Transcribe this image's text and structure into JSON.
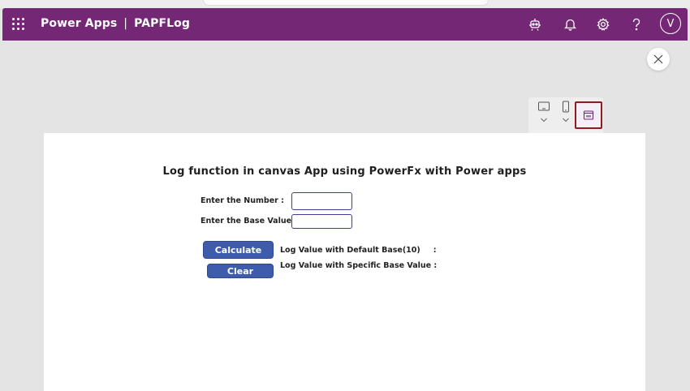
{
  "header": {
    "product": "Power Apps",
    "separator": "|",
    "app_name": "PAPFLog",
    "avatar_initial": "V"
  },
  "app": {
    "title": "Log function in canvas App using PowerFx with Power apps",
    "number_label": "Enter the Number :",
    "base_label": "Enter the Base Value :",
    "number_value": "",
    "base_value": "",
    "calculate_label": "Calculate",
    "clear_label": "Clear",
    "default_base_label": "Log Value with Default Base(10)",
    "default_base_colon": ":",
    "specific_base_label": "Log Value with Specific Base Value :"
  },
  "colors": {
    "topbar": "#742774",
    "button": "#3f5cac",
    "input_border": "#3b3f97",
    "selected_device_border": "#8a1c22"
  },
  "icons": {
    "waffle": "app-launcher-icon",
    "copilot": "copilot-icon",
    "notifications": "bell-icon",
    "settings": "gear-icon",
    "help": "help-icon",
    "close": "close-icon",
    "tablet": "tablet-icon",
    "phone": "phone-icon",
    "web": "web-browser-icon"
  }
}
